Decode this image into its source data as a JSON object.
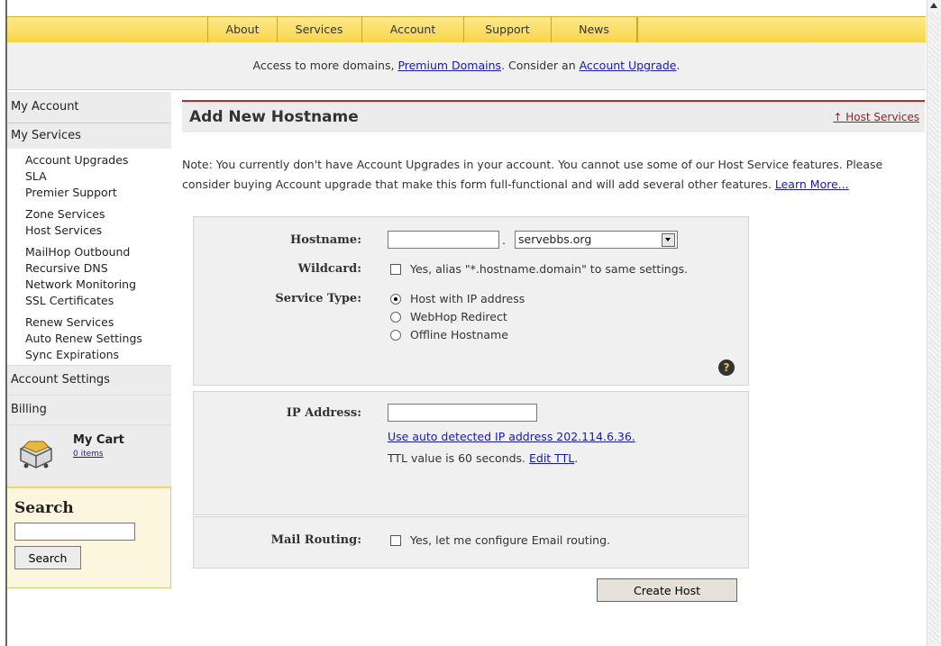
{
  "nav": {
    "items": [
      "About",
      "Services",
      "Account",
      "Support",
      "News"
    ]
  },
  "banner": {
    "prefix": "Access to more domains, ",
    "premium_link": "Premium Domains",
    "middle": ". Consider an ",
    "upgrade_link": "Account Upgrade",
    "suffix": "."
  },
  "sidebar": {
    "my_account": "My Account",
    "my_services": "My Services",
    "links_group1": [
      "Account Upgrades",
      "SLA",
      "Premier Support"
    ],
    "links_group2": [
      "Zone Services",
      "Host Services"
    ],
    "links_group3": [
      "MailHop Outbound",
      "Recursive DNS",
      "Network Monitoring",
      "SSL Certificates"
    ],
    "links_group4": [
      "Renew Services",
      "Auto Renew Settings",
      "Sync Expirations"
    ],
    "account_settings": "Account Settings",
    "billing": "Billing",
    "cart_title": "My Cart",
    "cart_items": "0 items",
    "search_title": "Search",
    "search_button": "Search"
  },
  "main": {
    "title": "Add New Hostname",
    "host_services_link": "↑ Host Services",
    "note_text": "Note: You currently don't have Account Upgrades in your account. You cannot use some of our Host Service features. Please consider buying Account upgrade that make this form full-functional and will add several other features. ",
    "learn_more": "Learn More..."
  },
  "form": {
    "hostname_label": "Hostname:",
    "hostname_value": "",
    "dot": ".",
    "domain_selected": "servebbs.org",
    "wildcard_label": "Wildcard:",
    "wildcard_text": "Yes, alias \"*.hostname.domain\" to same settings.",
    "service_type_label": "Service Type:",
    "service_options": [
      "Host with IP address",
      "WebHop Redirect",
      "Offline Hostname"
    ],
    "ip_label": "IP Address:",
    "ip_value": "",
    "auto_ip_link": "Use auto detected IP address 202.114.6.36.",
    "ttl_prefix": "TTL value is 60 seconds. ",
    "ttl_link": "Edit TTL",
    "ttl_suffix": ".",
    "mail_label": "Mail Routing:",
    "mail_text": "Yes, let me configure Email routing.",
    "create_button": "Create Host"
  }
}
